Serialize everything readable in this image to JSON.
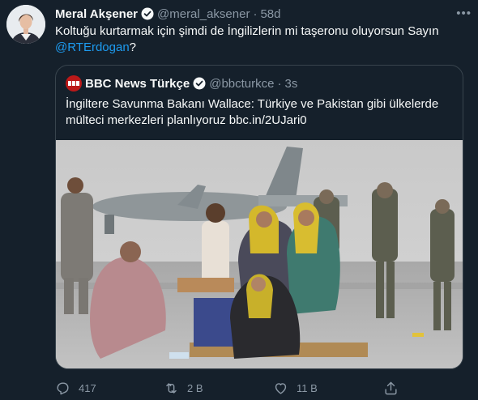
{
  "tweet": {
    "author_name": "Meral Akşener",
    "handle": "@meral_aksener",
    "separator": "·",
    "time": "58d",
    "text_main": "Koltuğu kurtarmak için şimdi de İngilizlerin mi taşeronu oluyorsun Sayın ",
    "mention": "@RTErdogan",
    "text_end": "?"
  },
  "quote": {
    "author_name": "BBC News Türkçe",
    "handle": "@bbcturkce",
    "separator": "·",
    "time": "3s",
    "text": "İngiltere Savunma Bakanı Wallace: Türkiye ve Pakistan gibi ülkelerde mülteci merkezleri planlıyoruz bbc.in/2UJari0"
  },
  "actions": {
    "reply_count": "417",
    "retweet_count": "2 B",
    "like_count": "11 B"
  },
  "colors": {
    "background": "#15202b",
    "text": "#f7f9f9",
    "secondary": "#8b98a5",
    "link": "#1d9bf0",
    "border": "#38444d"
  },
  "icons": [
    "verified-badge-icon",
    "more-icon",
    "bbc-logo-icon",
    "reply-icon",
    "retweet-icon",
    "like-icon",
    "share-icon"
  ]
}
